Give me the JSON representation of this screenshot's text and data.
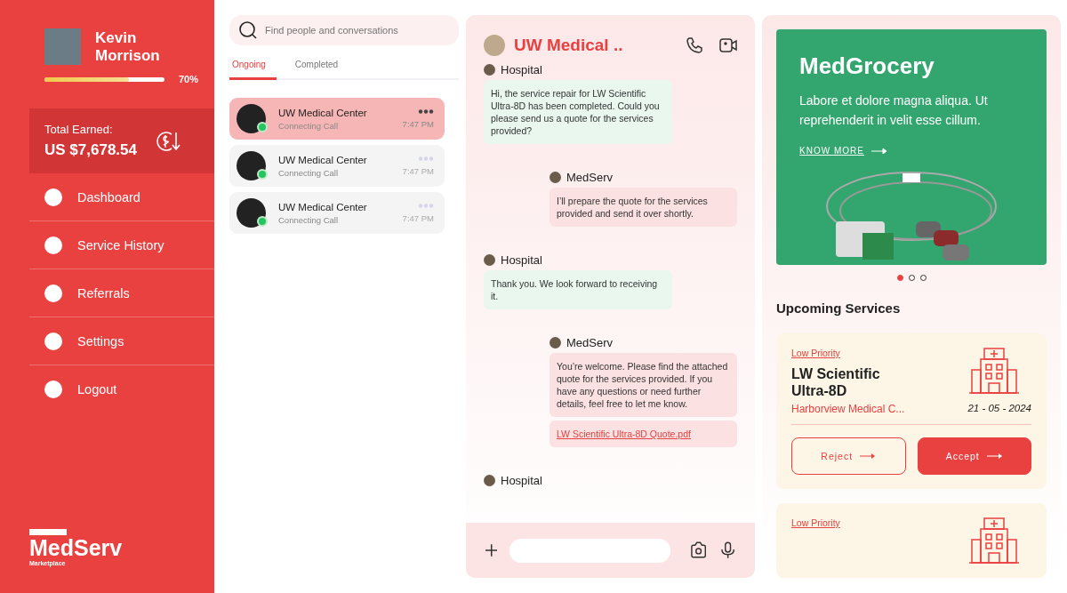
{
  "profile": {
    "name": "Kevin Morrison",
    "progress": {
      "level": 0.7,
      "reading": "70%"
    }
  },
  "earnings": {
    "label": "Total Earned:",
    "amount": "US $7,678.54"
  },
  "nav": [
    {
      "label": "Dashboard"
    },
    {
      "label": "Service History"
    },
    {
      "label": "Referrals"
    },
    {
      "label": "Settings"
    },
    {
      "label": "Logout"
    }
  ],
  "logo": {
    "name": "MedServ",
    "tagline": "Marketplace"
  },
  "search": {
    "placeholder": "Find people and conversations"
  },
  "tabs": [
    {
      "label": "Ongoing",
      "selected": true
    },
    {
      "label": "Completed",
      "selected": false
    }
  ],
  "conversations": [
    {
      "name": "UW Medical Center",
      "status": "Connecting Call",
      "time": "7:47 PM",
      "selected": true,
      "online": true
    },
    {
      "name": "UW Medical Center",
      "status": "Connecting Call",
      "time": "7:47 PM",
      "selected": false,
      "online": true
    },
    {
      "name": "UW Medical Center",
      "status": "Connecting Call",
      "time": "7:47 PM",
      "selected": false,
      "online": true
    }
  ],
  "chat": {
    "title": "UW Medical ..",
    "messages": [
      {
        "kind": "incoming",
        "sender": "Hospital",
        "parts": [
          {
            "kind": "text",
            "text": "Hi, the service repair for LW Scientific Ultra-8D has been completed. Could you please send us a quote for the services provided?"
          }
        ]
      },
      {
        "kind": "outgoing",
        "sender": "MedServ",
        "parts": [
          {
            "kind": "text",
            "text": "I’ll prepare the quote for the services provided and send it over shortly."
          }
        ]
      },
      {
        "kind": "incoming",
        "sender": "Hospital",
        "parts": [
          {
            "kind": "text",
            "text": "Thank you. We look forward to receiving it."
          }
        ]
      },
      {
        "kind": "outgoing",
        "sender": "MedServ",
        "parts": [
          {
            "kind": "text",
            "text": "You’re welcome. Please find the attached quote for the services provided. If you have any questions or need further details, feel free to let me know."
          },
          {
            "kind": "file",
            "text": "LW Scientific Ultra-8D Quote.pdf"
          }
        ]
      },
      {
        "kind": "incoming",
        "sender": "Hospital"
      }
    ]
  },
  "promo": {
    "title": "MedGrocery",
    "text": "Labore et dolore magna aliqua. Ut reprehenderit in velit esse cillum.",
    "link": "KNOW MORE",
    "dots": [
      {
        "selected": true
      },
      {
        "selected": false
      },
      {
        "selected": false
      }
    ]
  },
  "upcoming": {
    "title": "Upcoming Services",
    "cards": [
      {
        "priority": "Low Priority",
        "title": "LW Scientific Ultra-8D",
        "client": "Harborview Medical C...",
        "date": "21 - 05 - 2024",
        "actions": [
          {
            "kind": "outline",
            "label": "Reject"
          },
          {
            "kind": "filled",
            "label": "Accept"
          }
        ]
      },
      {
        "priority": "Low Priority"
      }
    ]
  }
}
